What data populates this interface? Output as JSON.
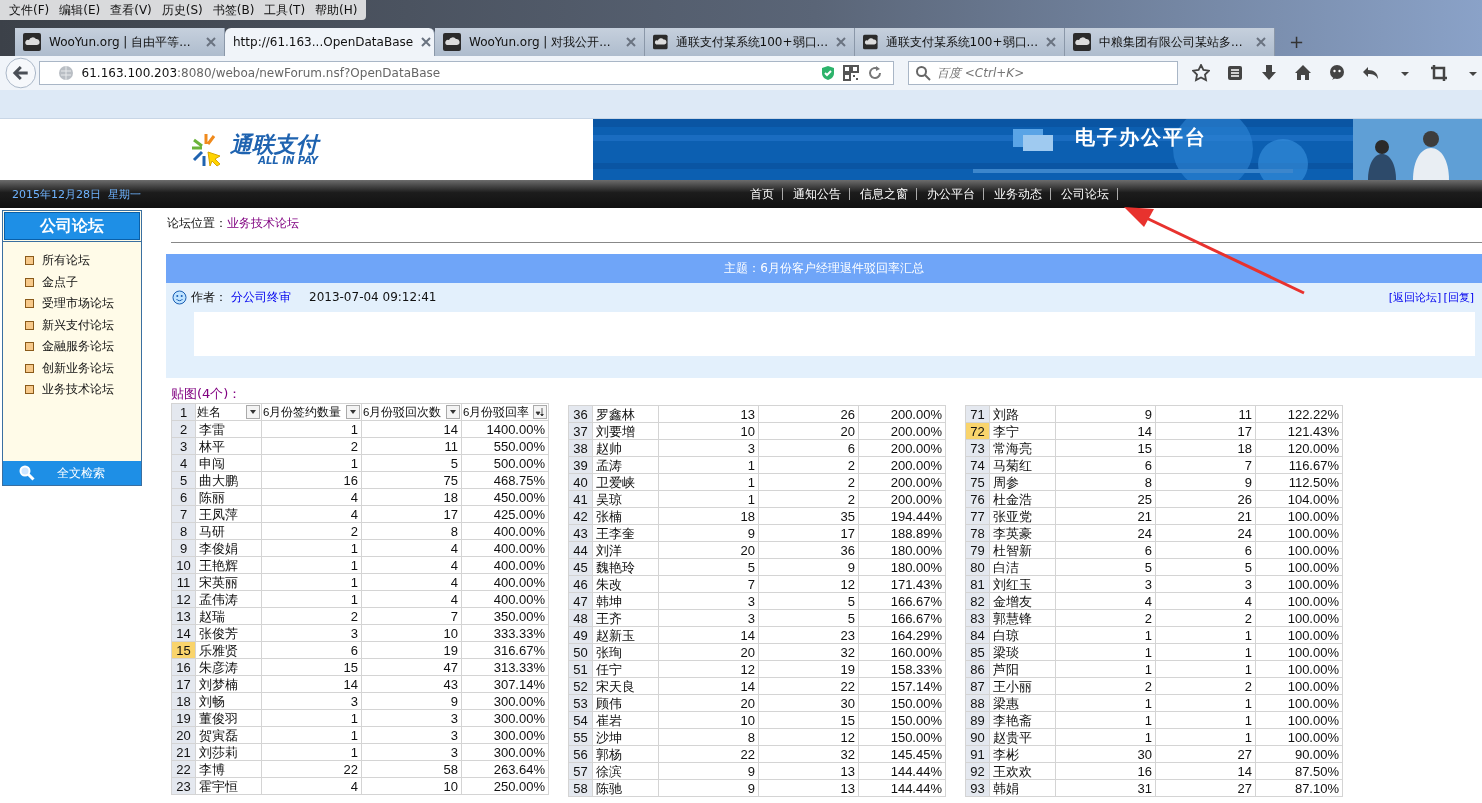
{
  "browser": {
    "menu": [
      "文件(F)",
      "编辑(E)",
      "查看(V)",
      "历史(S)",
      "书签(B)",
      "工具(T)",
      "帮助(H)"
    ],
    "tabs": [
      {
        "title": "WooYun.org | 自由平等...",
        "selected": false
      },
      {
        "title": "http://61.163...OpenDataBase",
        "selected": true
      },
      {
        "title": "WooYun.org | 对我公开...",
        "selected": false
      },
      {
        "title": "通联支付某系统100+弱口...",
        "selected": false
      },
      {
        "title": "通联支付某系统100+弱口...",
        "selected": false
      },
      {
        "title": "中粮集团有限公司某站多...",
        "selected": false
      }
    ],
    "new_tab": "+",
    "address": {
      "host": "61.163.100.203",
      "path": ":8080/weboa/newForum.nsf?OpenDataBase"
    },
    "search": {
      "placeholder": "百度 <Ctrl+K>"
    }
  },
  "header": {
    "logo_name": "通联支付",
    "logo_sub": "ALL IN PAY",
    "banner_title": "电子办公平台"
  },
  "topbar": {
    "date": "2015年12月28日  星期一",
    "nav": [
      "首页",
      "通知公告",
      "信息之窗",
      "办公平台",
      "业务动态",
      "公司论坛"
    ]
  },
  "sidebar": {
    "title": "公司论坛",
    "items": [
      "所有论坛",
      "金点子",
      "受理市场论坛",
      "新兴支付论坛",
      "金融服务论坛",
      "创新业务论坛",
      "业务技术论坛"
    ],
    "search_button": "全文检索"
  },
  "forum": {
    "location_label": "论坛位置：",
    "location": "业务技术论坛",
    "subject": "主题：6月份客户经理退件驳回率汇总",
    "author_label": "作者：",
    "author": "分公司终审",
    "time": "2013-07-04 09:12:41",
    "links": [
      "[返回论坛]",
      "[回复]"
    ],
    "attachments_label": "贴图(4个)："
  },
  "sheets": [
    {
      "header": {
        "number": "1",
        "columns": [
          {
            "label": "姓名",
            "kind": "filter"
          },
          {
            "label": "6月份签约数量",
            "kind": "filter"
          },
          {
            "label": "6月份驳回次数",
            "kind": "filter"
          },
          {
            "label": "6月份驳回率",
            "kind": "sort"
          }
        ]
      },
      "rows": [
        {
          "cells": [
            "2",
            "李雷",
            "1",
            "14",
            "1400.00%"
          ],
          "selected": false
        },
        {
          "cells": [
            "3",
            "林平",
            "2",
            "11",
            "550.00%"
          ],
          "selected": false
        },
        {
          "cells": [
            "4",
            "申闯",
            "1",
            "5",
            "500.00%"
          ],
          "selected": false
        },
        {
          "cells": [
            "5",
            "曲大鹏",
            "16",
            "75",
            "468.75%"
          ],
          "selected": false
        },
        {
          "cells": [
            "6",
            "陈丽",
            "4",
            "18",
            "450.00%"
          ],
          "selected": false
        },
        {
          "cells": [
            "7",
            "王凤萍",
            "4",
            "17",
            "425.00%"
          ],
          "selected": false
        },
        {
          "cells": [
            "8",
            "马研",
            "2",
            "8",
            "400.00%"
          ],
          "selected": false
        },
        {
          "cells": [
            "9",
            "李俊娟",
            "1",
            "4",
            "400.00%"
          ],
          "selected": false
        },
        {
          "cells": [
            "10",
            "王艳辉",
            "1",
            "4",
            "400.00%"
          ],
          "selected": false
        },
        {
          "cells": [
            "11",
            "宋英丽",
            "1",
            "4",
            "400.00%"
          ],
          "selected": false
        },
        {
          "cells": [
            "12",
            "孟伟涛",
            "1",
            "4",
            "400.00%"
          ],
          "selected": false
        },
        {
          "cells": [
            "13",
            "赵瑞",
            "2",
            "7",
            "350.00%"
          ],
          "selected": false
        },
        {
          "cells": [
            "14",
            "张俊芳",
            "3",
            "10",
            "333.33%"
          ],
          "selected": false
        },
        {
          "cells": [
            "15",
            "乐雅贤",
            "6",
            "19",
            "316.67%"
          ],
          "selected": true
        },
        {
          "cells": [
            "16",
            "朱彦涛",
            "15",
            "47",
            "313.33%"
          ],
          "selected": false
        },
        {
          "cells": [
            "17",
            "刘梦楠",
            "14",
            "43",
            "307.14%"
          ],
          "selected": false
        },
        {
          "cells": [
            "18",
            "刘畅",
            "3",
            "9",
            "300.00%"
          ],
          "selected": false
        },
        {
          "cells": [
            "19",
            "董俊羽",
            "1",
            "3",
            "300.00%"
          ],
          "selected": false
        },
        {
          "cells": [
            "20",
            "贺寅磊",
            "1",
            "3",
            "300.00%"
          ],
          "selected": false
        },
        {
          "cells": [
            "21",
            "刘莎莉",
            "1",
            "3",
            "300.00%"
          ],
          "selected": false
        },
        {
          "cells": [
            "22",
            "李博",
            "22",
            "58",
            "263.64%"
          ],
          "selected": false
        },
        {
          "cells": [
            "23",
            "霍宇恒",
            "4",
            "10",
            "250.00%"
          ],
          "selected": false
        }
      ]
    },
    {
      "rows": [
        {
          "cells": [
            "36",
            "罗鑫林",
            "13",
            "26",
            "200.00%"
          ],
          "selected": false
        },
        {
          "cells": [
            "37",
            "刘要增",
            "10",
            "20",
            "200.00%"
          ],
          "selected": false
        },
        {
          "cells": [
            "38",
            "赵帅",
            "3",
            "6",
            "200.00%"
          ],
          "selected": false
        },
        {
          "cells": [
            "39",
            "孟涛",
            "1",
            "2",
            "200.00%"
          ],
          "selected": false
        },
        {
          "cells": [
            "40",
            "卫爱峡",
            "1",
            "2",
            "200.00%"
          ],
          "selected": false
        },
        {
          "cells": [
            "41",
            "吴琼",
            "1",
            "2",
            "200.00%"
          ],
          "selected": false
        },
        {
          "cells": [
            "42",
            "张楠",
            "18",
            "35",
            "194.44%"
          ],
          "selected": false
        },
        {
          "cells": [
            "43",
            "王李奎",
            "9",
            "17",
            "188.89%"
          ],
          "selected": false
        },
        {
          "cells": [
            "44",
            "刘洋",
            "20",
            "36",
            "180.00%"
          ],
          "selected": false
        },
        {
          "cells": [
            "45",
            "魏艳玲",
            "5",
            "9",
            "180.00%"
          ],
          "selected": false
        },
        {
          "cells": [
            "46",
            "朱改",
            "7",
            "12",
            "171.43%"
          ],
          "selected": false
        },
        {
          "cells": [
            "47",
            "韩坤",
            "3",
            "5",
            "166.67%"
          ],
          "selected": false
        },
        {
          "cells": [
            "48",
            "王齐",
            "3",
            "5",
            "166.67%"
          ],
          "selected": false
        },
        {
          "cells": [
            "49",
            "赵新玉",
            "14",
            "23",
            "164.29%"
          ],
          "selected": false
        },
        {
          "cells": [
            "50",
            "张珣",
            "20",
            "32",
            "160.00%"
          ],
          "selected": false
        },
        {
          "cells": [
            "51",
            "任宁",
            "12",
            "19",
            "158.33%"
          ],
          "selected": false
        },
        {
          "cells": [
            "52",
            "宋天良",
            "14",
            "22",
            "157.14%"
          ],
          "selected": false
        },
        {
          "cells": [
            "53",
            "顾伟",
            "20",
            "30",
            "150.00%"
          ],
          "selected": false
        },
        {
          "cells": [
            "54",
            "崔岩",
            "10",
            "15",
            "150.00%"
          ],
          "selected": false
        },
        {
          "cells": [
            "55",
            "沙坤",
            "8",
            "12",
            "150.00%"
          ],
          "selected": false
        },
        {
          "cells": [
            "56",
            "郭杨",
            "22",
            "32",
            "145.45%"
          ],
          "selected": false
        },
        {
          "cells": [
            "57",
            "徐滨",
            "9",
            "13",
            "144.44%"
          ],
          "selected": false
        },
        {
          "cells": [
            "58",
            "陈驰",
            "9",
            "13",
            "144.44%"
          ],
          "selected": false
        }
      ]
    },
    {
      "rows": [
        {
          "cells": [
            "71",
            "刘路",
            "9",
            "11",
            "122.22%"
          ],
          "selected": false
        },
        {
          "cells": [
            "72",
            "李宁",
            "14",
            "17",
            "121.43%"
          ],
          "selected": true
        },
        {
          "cells": [
            "73",
            "常海亮",
            "15",
            "18",
            "120.00%"
          ],
          "selected": false
        },
        {
          "cells": [
            "74",
            "马菊红",
            "6",
            "7",
            "116.67%"
          ],
          "selected": false
        },
        {
          "cells": [
            "75",
            "周参",
            "8",
            "9",
            "112.50%"
          ],
          "selected": false
        },
        {
          "cells": [
            "76",
            "杜金浩",
            "25",
            "26",
            "104.00%"
          ],
          "selected": false
        },
        {
          "cells": [
            "77",
            "张亚党",
            "21",
            "21",
            "100.00%"
          ],
          "selected": false
        },
        {
          "cells": [
            "78",
            "李英豪",
            "24",
            "24",
            "100.00%"
          ],
          "selected": false
        },
        {
          "cells": [
            "79",
            "杜智新",
            "6",
            "6",
            "100.00%"
          ],
          "selected": false
        },
        {
          "cells": [
            "80",
            "白洁",
            "5",
            "5",
            "100.00%"
          ],
          "selected": false
        },
        {
          "cells": [
            "81",
            "刘红玉",
            "3",
            "3",
            "100.00%"
          ],
          "selected": false
        },
        {
          "cells": [
            "82",
            "金增友",
            "4",
            "4",
            "100.00%"
          ],
          "selected": false
        },
        {
          "cells": [
            "83",
            "郭慧锋",
            "2",
            "2",
            "100.00%"
          ],
          "selected": false
        },
        {
          "cells": [
            "84",
            "白琼",
            "1",
            "1",
            "100.00%"
          ],
          "selected": false
        },
        {
          "cells": [
            "85",
            "梁琰",
            "1",
            "1",
            "100.00%"
          ],
          "selected": false
        },
        {
          "cells": [
            "86",
            "芦阳",
            "1",
            "1",
            "100.00%"
          ],
          "selected": false
        },
        {
          "cells": [
            "87",
            "王小丽",
            "2",
            "2",
            "100.00%"
          ],
          "selected": false
        },
        {
          "cells": [
            "88",
            "梁惠",
            "1",
            "1",
            "100.00%"
          ],
          "selected": false
        },
        {
          "cells": [
            "89",
            "李艳斋",
            "1",
            "1",
            "100.00%"
          ],
          "selected": false
        },
        {
          "cells": [
            "90",
            "赵贵平",
            "1",
            "1",
            "100.00%"
          ],
          "selected": false
        },
        {
          "cells": [
            "91",
            "李彬",
            "30",
            "27",
            "90.00%"
          ],
          "selected": false
        },
        {
          "cells": [
            "92",
            "王欢欢",
            "16",
            "14",
            "87.50%"
          ],
          "selected": false
        },
        {
          "cells": [
            "93",
            "韩娟",
            "31",
            "27",
            "87.10%"
          ],
          "selected": false
        }
      ]
    }
  ]
}
